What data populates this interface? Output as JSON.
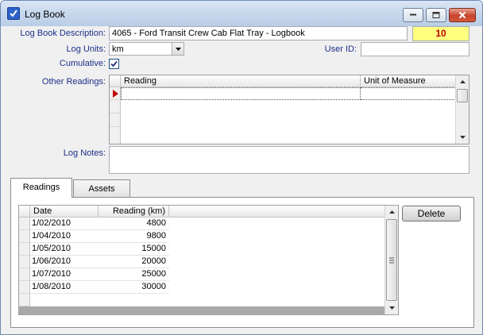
{
  "window": {
    "title": "Log Book",
    "icon": "checkbox-app-icon"
  },
  "form": {
    "description_label": "Log Book Description:",
    "description_value": "4065 - Ford Transit Crew Cab Flat Tray - Logbook",
    "record_count": "10",
    "units_label": "Log Units:",
    "units_value": "km",
    "user_id_label": "User ID:",
    "user_id_value": "",
    "cumulative_label": "Cumulative:",
    "cumulative_checked": true,
    "other_readings_label": "Other Readings:",
    "other_readings_headers": [
      "Reading",
      "Unit of Measure"
    ],
    "log_notes_label": "Log Notes:",
    "log_notes_value": ""
  },
  "tabs": {
    "items": [
      "Readings",
      "Assets"
    ],
    "active": "Readings"
  },
  "readings": {
    "headers": [
      "Date",
      "Reading (km)"
    ],
    "rows": [
      {
        "date": "1/02/2010",
        "reading": "4800"
      },
      {
        "date": "1/04/2010",
        "reading": "9800"
      },
      {
        "date": "1/05/2010",
        "reading": "15000"
      },
      {
        "date": "1/06/2010",
        "reading": "20000"
      },
      {
        "date": "1/07/2010",
        "reading": "25000"
      },
      {
        "date": "1/08/2010",
        "reading": "30000"
      }
    ],
    "delete_label": "Delete"
  },
  "colors": {
    "label_blue": "#1c2f8a",
    "badge_bg": "#ffff80",
    "badge_text": "#c00000",
    "titlebar": "#c9d9ee"
  }
}
